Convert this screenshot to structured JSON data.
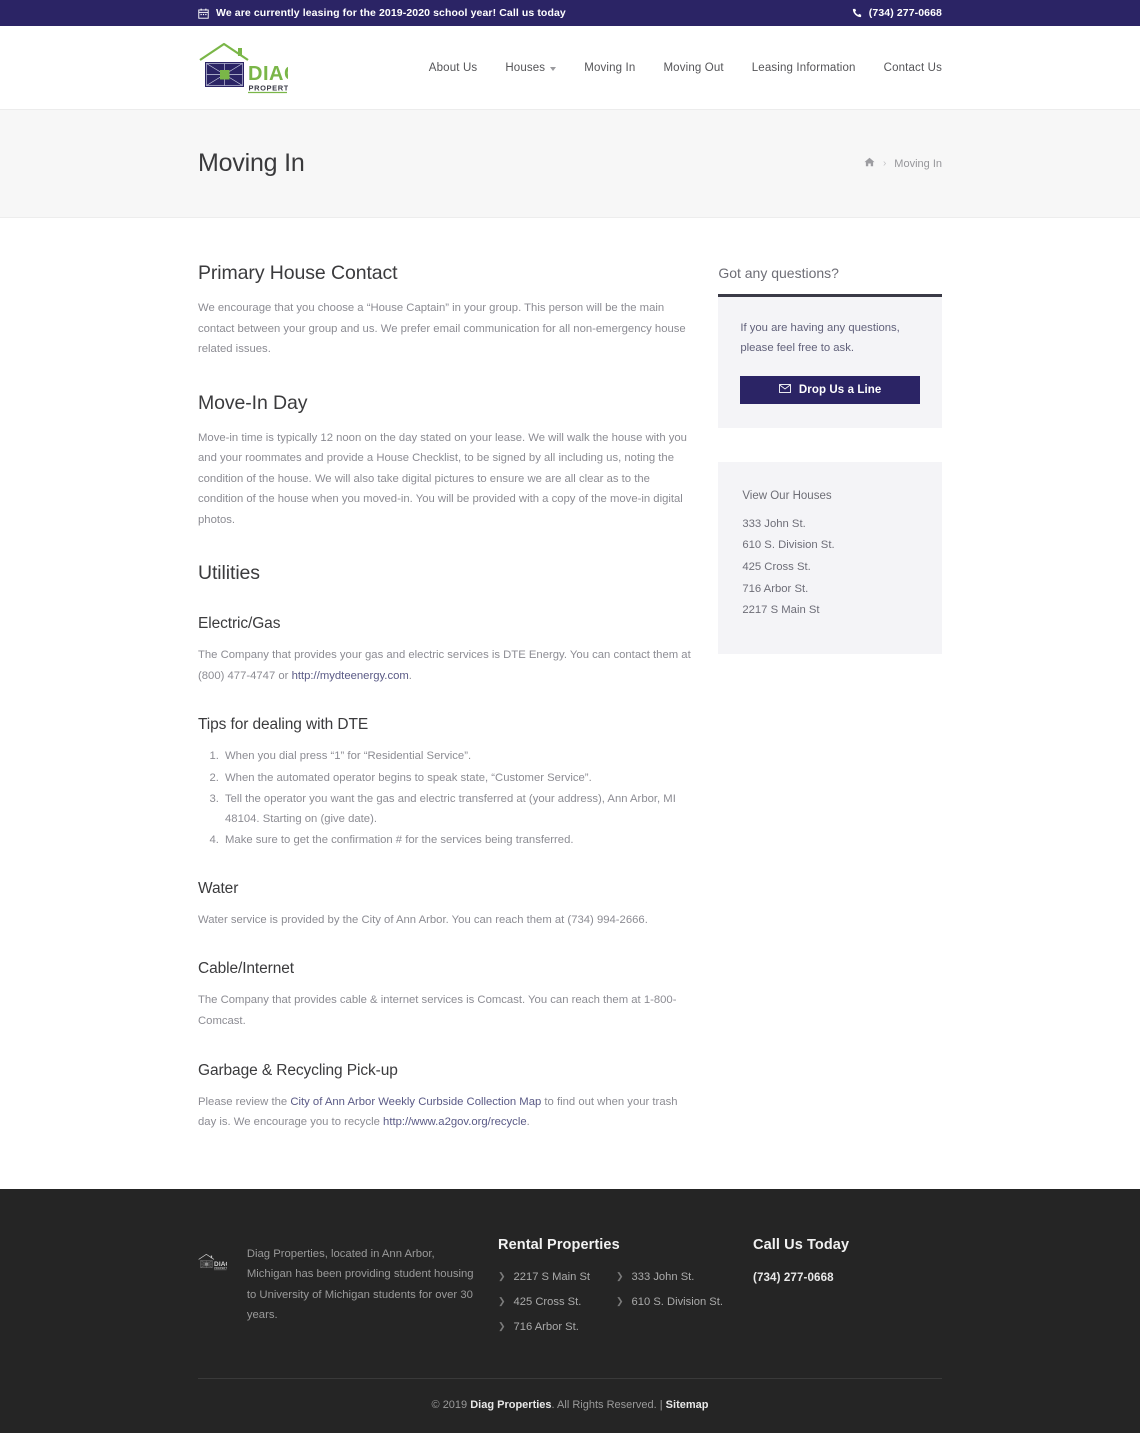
{
  "topbar": {
    "calendar_icon": "calendar-icon",
    "announcement": "We are currently leasing for the 2019-2020 school year! Call us today",
    "phone_icon": "phone-icon",
    "phone": "(734) 277-0668"
  },
  "header": {
    "logo_alt": "Diag Properties",
    "logo_primary": "DIAG",
    "logo_secondary": "PROPERTIES",
    "nav": [
      {
        "label": "About Us",
        "has_dropdown": false
      },
      {
        "label": "Houses",
        "has_dropdown": true
      },
      {
        "label": "Moving In",
        "has_dropdown": false
      },
      {
        "label": "Moving Out",
        "has_dropdown": false
      },
      {
        "label": "Leasing Information",
        "has_dropdown": false
      },
      {
        "label": "Contact Us",
        "has_dropdown": false
      }
    ]
  },
  "titlebar": {
    "title": "Moving In",
    "breadcrumb": {
      "home_icon": "home-icon",
      "separator": "›",
      "current": "Moving In"
    }
  },
  "content": {
    "primary_contact": {
      "heading": "Primary House Contact",
      "paragraph": "We encourage that you choose a “House Captain” in your group. This person will be the main contact between your group and us. We prefer email communication for all non-emergency house related issues."
    },
    "move_in_day": {
      "heading": "Move-In Day",
      "paragraph": "Move-in time is typically 12 noon on the day stated on your lease.  We will walk the house with you and your roommates and provide a House Checklist, to be signed by all including us, noting the condition of the house. We will also take digital pictures to ensure we are all clear as to the condition of the house when you moved-in.  You will be provided with a copy of the move-in digital photos."
    },
    "utilities": {
      "heading": "Utilities",
      "electric_gas": {
        "heading": "Electric/Gas",
        "text_before": "The Company that provides your gas and electric services is DTE Energy. You can contact them at (800) 477-4747 or ",
        "link": "http://mydteenergy.com",
        "text_after": "."
      },
      "dte_tips": {
        "heading": "Tips for dealing with DTE",
        "items": [
          "When you dial press “1” for “Residential Service”.",
          "When the automated operator begins to speak state, “Customer Service”.",
          "Tell the operator you want the gas and electric transferred at (your address), Ann Arbor, MI 48104. Starting on (give date).",
          "Make sure to get the confirmation # for the services being transferred."
        ]
      },
      "water": {
        "heading": "Water",
        "paragraph": "Water service is provided by the City of Ann Arbor. You can reach them at (734) 994-2666."
      },
      "cable": {
        "heading": "Cable/Internet",
        "paragraph": "The Company that provides cable & internet services is Comcast. You can reach them at 1-800-Comcast."
      },
      "garbage": {
        "heading": "Garbage & Recycling Pick-up",
        "text_before": "Please review the ",
        "link1": "City of Ann Arbor Weekly Curbside Collection Map",
        "text_middle": " to find out when your trash day is.  We encourage you to recycle ",
        "link2": "http://www.a2gov.org/recycle",
        "text_after": "."
      }
    }
  },
  "sidebar": {
    "questions_widget": {
      "title": "Got any questions?",
      "text": "If you are having any questions, please feel free to ask.",
      "button_label": "Drop Us a Line",
      "button_icon": "envelope-icon",
      "button_color": "#2b2465"
    },
    "houses_widget": {
      "title": "View Our Houses",
      "houses": [
        "333 John St.",
        "610 S. Division St.",
        "425 Cross St.",
        "716 Arbor St.",
        "2217 S Main St"
      ]
    }
  },
  "footer": {
    "logo_primary": "DIAG",
    "logo_secondary": "PROPERTIES",
    "about": "Diag Properties, located in Ann Arbor, Michigan has been providing student housing to University of Michigan students for over 30 years.",
    "rental_properties": {
      "heading": "Rental Properties",
      "column1": [
        "2217 S Main St",
        "425 Cross St.",
        "716 Arbor St."
      ],
      "column2": [
        "333 John St.",
        "610 S. Division St."
      ]
    },
    "call_us": {
      "heading": "Call Us Today",
      "phone": "(734) 277-0668"
    },
    "copyright": {
      "prefix": "© 2019 ",
      "brand": "Diag Properties",
      "middle": ". All Rights Reserved. | ",
      "sitemap": "Sitemap"
    }
  },
  "colors": {
    "brand_navy": "#2b2465",
    "logo_green": "#7ab648",
    "footer_bg": "#252525",
    "link": "#5a5a86"
  }
}
